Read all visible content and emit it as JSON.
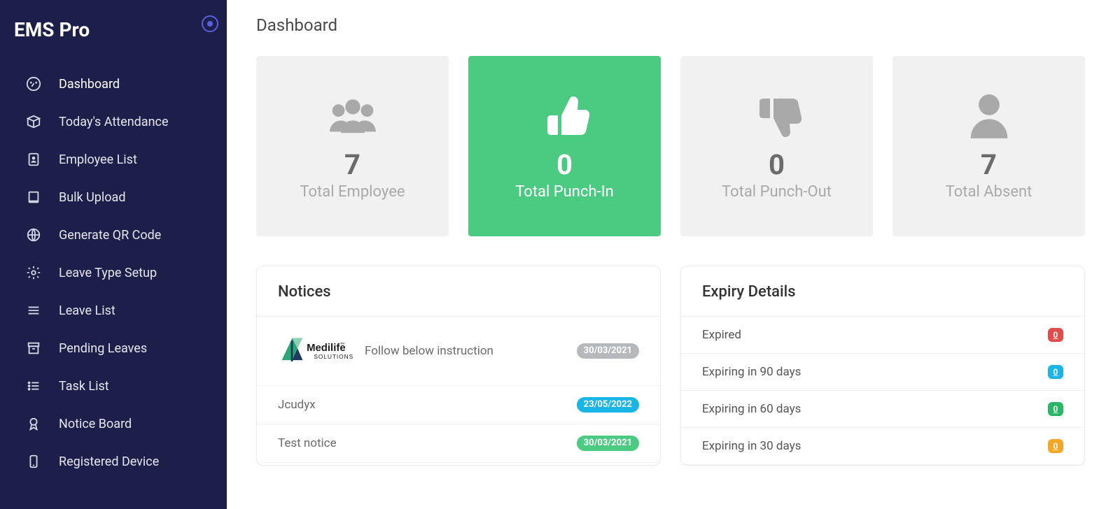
{
  "brand": "EMS Pro",
  "page_title": "Dashboard",
  "sidebar": {
    "items": [
      {
        "label": "Dashboard",
        "icon": "dashboard-icon"
      },
      {
        "label": "Today's Attendance",
        "icon": "box-icon"
      },
      {
        "label": "Employee List",
        "icon": "id-card-icon"
      },
      {
        "label": "Bulk Upload",
        "icon": "book-icon"
      },
      {
        "label": "Generate QR Code",
        "icon": "globe-icon"
      },
      {
        "label": "Leave Type Setup",
        "icon": "gear-icon"
      },
      {
        "label": "Leave List",
        "icon": "lines-icon"
      },
      {
        "label": "Pending Leaves",
        "icon": "archive-icon"
      },
      {
        "label": "Task List",
        "icon": "list-icon"
      },
      {
        "label": "Notice Board",
        "icon": "award-icon"
      },
      {
        "label": "Registered Device",
        "icon": "device-icon"
      }
    ]
  },
  "cards": [
    {
      "value": "7",
      "label": "Total Employee",
      "icon": "users-icon",
      "style": "plain"
    },
    {
      "value": "0",
      "label": "Total Punch-In",
      "icon": "thumbs-up-icon",
      "style": "green"
    },
    {
      "value": "0",
      "label": "Total Punch-Out",
      "icon": "thumbs-down-icon",
      "style": "plain"
    },
    {
      "value": "7",
      "label": "Total Absent",
      "icon": "person-icon",
      "style": "plain"
    }
  ],
  "notices": {
    "title": "Notices",
    "items": [
      {
        "text": "Follow below instruction",
        "date": "30/03/2021",
        "pill": "gray",
        "logo": {
          "name": "Medilife",
          "sub": "SOLUTIONS"
        }
      },
      {
        "text": "Jcudyx",
        "date": "23/05/2022",
        "pill": "blue"
      },
      {
        "text": "Test notice",
        "date": "30/03/2021",
        "pill": "green2"
      }
    ]
  },
  "expiry": {
    "title": "Expiry Details",
    "items": [
      {
        "label": "Expired",
        "count": "0",
        "badge": "red"
      },
      {
        "label": "Expiring in 90 days",
        "count": "0",
        "badge": "cyan"
      },
      {
        "label": "Expiring in 60 days",
        "count": "0",
        "badge": "greenb"
      },
      {
        "label": "Expiring in 30 days",
        "count": "0",
        "badge": "orange"
      }
    ]
  }
}
